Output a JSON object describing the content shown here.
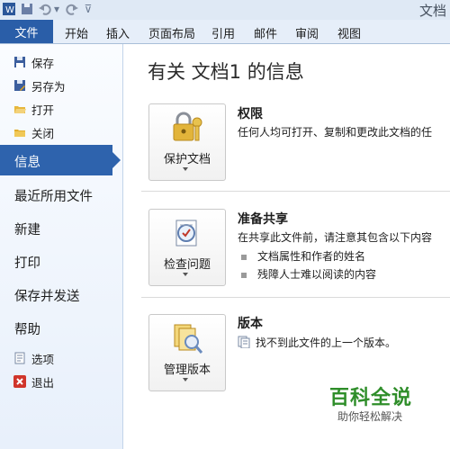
{
  "window": {
    "title": "文档"
  },
  "quick_access": {
    "icons": [
      "word-app-icon",
      "save-icon",
      "undo-icon",
      "redo-icon",
      "customize-icon"
    ]
  },
  "ribbon": {
    "file_tab": "文件",
    "tabs": [
      "开始",
      "插入",
      "页面布局",
      "引用",
      "邮件",
      "审阅",
      "视图"
    ]
  },
  "nav": {
    "save": "保存",
    "save_as": "另存为",
    "open": "打开",
    "close": "关闭",
    "info": "信息",
    "recent": "最近所用文件",
    "new": "新建",
    "print": "打印",
    "save_send": "保存并发送",
    "help": "帮助",
    "options": "选项",
    "exit": "退出"
  },
  "main": {
    "title": "有关 文档1 的信息",
    "permissions": {
      "button": "保护文档",
      "title": "权限",
      "desc": "任何人均可打开、复制和更改此文档的任"
    },
    "sharing": {
      "button": "检查问题",
      "title": "准备共享",
      "desc": "在共享此文件前，请注意其包含以下内容",
      "items": [
        "文档属性和作者的姓名",
        "残障人士难以阅读的内容"
      ]
    },
    "versions": {
      "button": "管理版本",
      "title": "版本",
      "desc": "找不到此文件的上一个版本。"
    }
  },
  "watermark": {
    "main": "百科全说",
    "sub": "助你轻松解决"
  },
  "colors": {
    "accent": "#2e63ad",
    "file_tab": "#2a5ea8",
    "watermark": "#2f8e2a"
  }
}
